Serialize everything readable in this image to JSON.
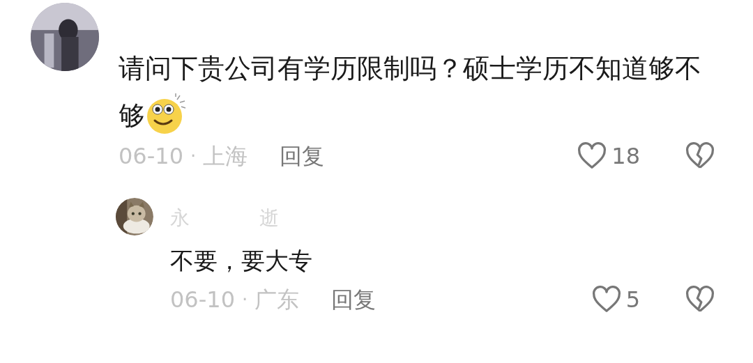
{
  "comments": [
    {
      "avatar": {
        "kind": "picture"
      },
      "text": "请问下贵公司有学历限制吗？硕士学历不知道够不够",
      "has_emoji": true,
      "date": "06-10",
      "separator": "·",
      "location": "上海",
      "reply_label": "回复",
      "likes": "18",
      "liked": false,
      "replies": [
        {
          "avatar": {
            "kind": "picture"
          },
          "username_parts": [
            "永",
            "逝"
          ],
          "text": "不要，要大专",
          "date": "06-10",
          "separator": "·",
          "location": "广东",
          "reply_label": "回复",
          "likes": "5",
          "liked": false
        }
      ]
    }
  ]
}
